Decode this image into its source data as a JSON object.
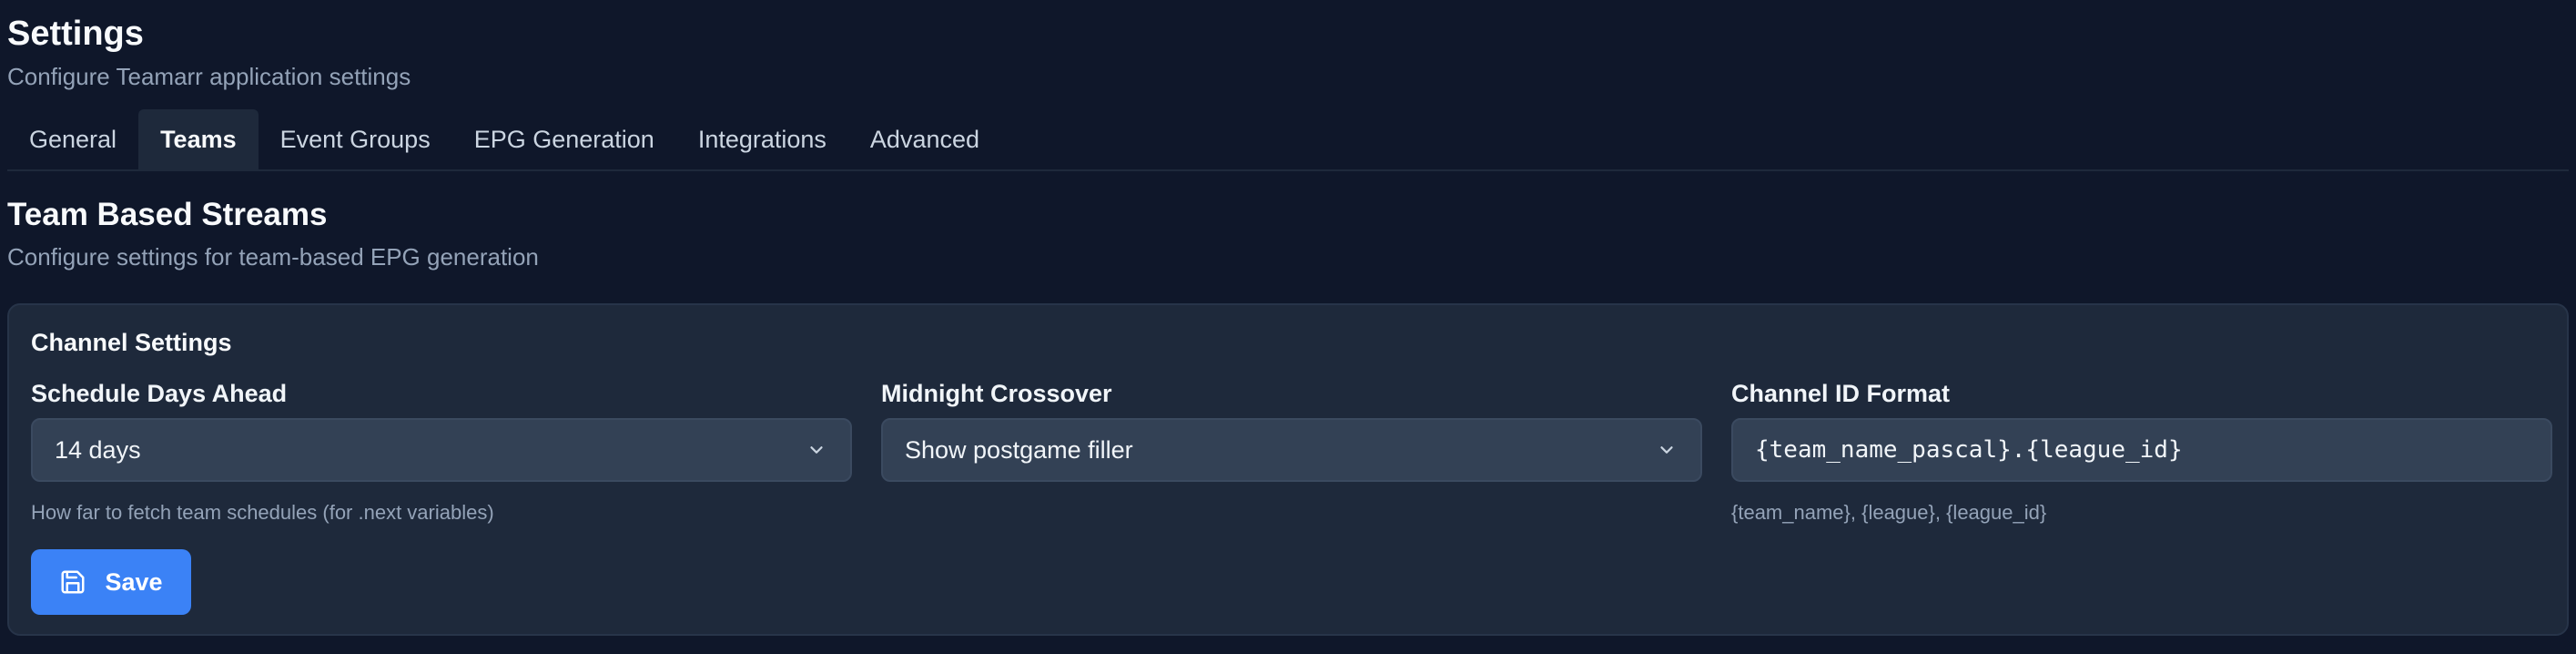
{
  "page": {
    "title": "Settings",
    "subtitle": "Configure Teamarr application settings"
  },
  "tabs": [
    {
      "label": "General",
      "active": false
    },
    {
      "label": "Teams",
      "active": true
    },
    {
      "label": "Event Groups",
      "active": false
    },
    {
      "label": "EPG Generation",
      "active": false
    },
    {
      "label": "Integrations",
      "active": false
    },
    {
      "label": "Advanced",
      "active": false
    }
  ],
  "section": {
    "title": "Team Based Streams",
    "subtitle": "Configure settings for team-based EPG generation"
  },
  "channel_settings": {
    "title": "Channel Settings",
    "schedule_days": {
      "label": "Schedule Days Ahead",
      "value": "14 days",
      "hint": "How far to fetch team schedules (for .next variables)"
    },
    "midnight_crossover": {
      "label": "Midnight Crossover",
      "value": "Show postgame filler"
    },
    "channel_id_format": {
      "label": "Channel ID Format",
      "value": "{team_name_pascal}.{league_id}",
      "hint": "{team_name}, {league}, {league_id}"
    },
    "save_label": "Save"
  },
  "colors": {
    "background": "#0f172a",
    "card": "#1e293b",
    "input": "#334155",
    "accent": "#3b82f6"
  },
  "icons": {
    "select_chevron": "chevron-down-icon",
    "save": "save-icon"
  }
}
